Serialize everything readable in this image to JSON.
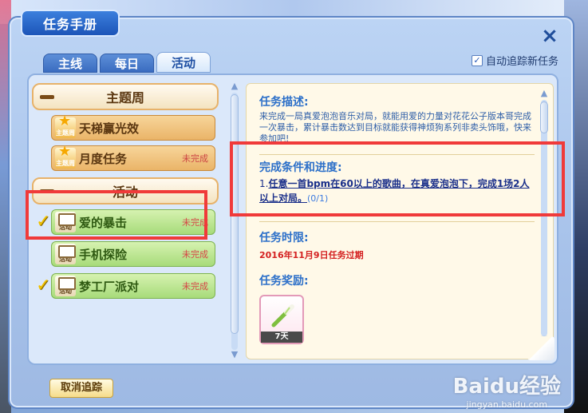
{
  "window": {
    "title": "任务手册",
    "close_icon": "×",
    "auto_track_label": "自动追踪新任务",
    "auto_track_checked": true
  },
  "tabs": [
    {
      "label": "主线",
      "active": false
    },
    {
      "label": "每日",
      "active": false
    },
    {
      "label": "活动",
      "active": true
    }
  ],
  "list": {
    "groups": [
      {
        "title": "主题周",
        "quests": [
          {
            "icon_text": "主题周",
            "name": "天梯赢光效",
            "status": ""
          },
          {
            "icon_text": "主题周",
            "name": "月度任务",
            "status": "未完成"
          }
        ]
      },
      {
        "title": "活动",
        "quests": [
          {
            "icon_text": "活动",
            "name": "爱的暴击",
            "status": "未完成",
            "tracked": true
          },
          {
            "icon_text": "活动",
            "name": "手机探险",
            "status": "未完成",
            "tracked": false
          },
          {
            "icon_text": "活动",
            "name": "梦工厂派对",
            "status": "未完成",
            "tracked": true
          }
        ]
      }
    ]
  },
  "detail": {
    "desc_title": "任务描述:",
    "desc_text": "来完成一局真爱泡泡音乐对局，就能用爱的力量对花花公子版本哥完成一次暴击，累计暴击数达到目标就能获得神烦狗系列非卖头饰哦，快来参加吧!",
    "cond_title": "完成条件和进度:",
    "cond_num": "1.",
    "cond_text": "任意一首bpm在60以上的歌曲，在真爱泡泡下，完成1场2人以上对局。",
    "cond_progress": "(0/1)",
    "deadline_title": "任务时限:",
    "deadline_text": "2016年11月9日任务过期",
    "reward_title": "任务奖励:",
    "reward_days": "7天"
  },
  "footer": {
    "untrack_label": "取消追踪"
  },
  "watermark": {
    "logo": "Baidu经验",
    "url": "jingyan.baidu.com"
  }
}
